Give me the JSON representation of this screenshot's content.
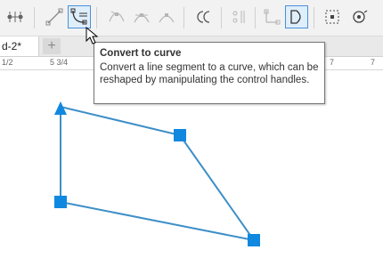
{
  "document": {
    "tab_label": "d-2*",
    "add_tab_symbol": "+"
  },
  "ruler": {
    "labels": [
      "1/2",
      "5 3/4",
      "7",
      "7"
    ]
  },
  "tooltip": {
    "title": "Convert to curve",
    "description": "Convert a line segment to a curve, which can be reshaped by manipulating the control handles."
  },
  "toolbar": {
    "tools": [
      "node-align-icon",
      "convert-to-line-icon",
      "convert-to-curve-icon",
      "cusp-node-icon",
      "smooth-node-icon",
      "symmetrical-node-icon",
      "reverse-direction-icon",
      "extract-subpath-icon",
      "elastic-mode-icon",
      "close-curve-icon",
      "select-all-nodes-icon",
      "reduce-nodes-icon"
    ]
  },
  "colors": {
    "accent": "#1a8fd6",
    "line": "#3d8fc7",
    "node": "#1088e0"
  }
}
